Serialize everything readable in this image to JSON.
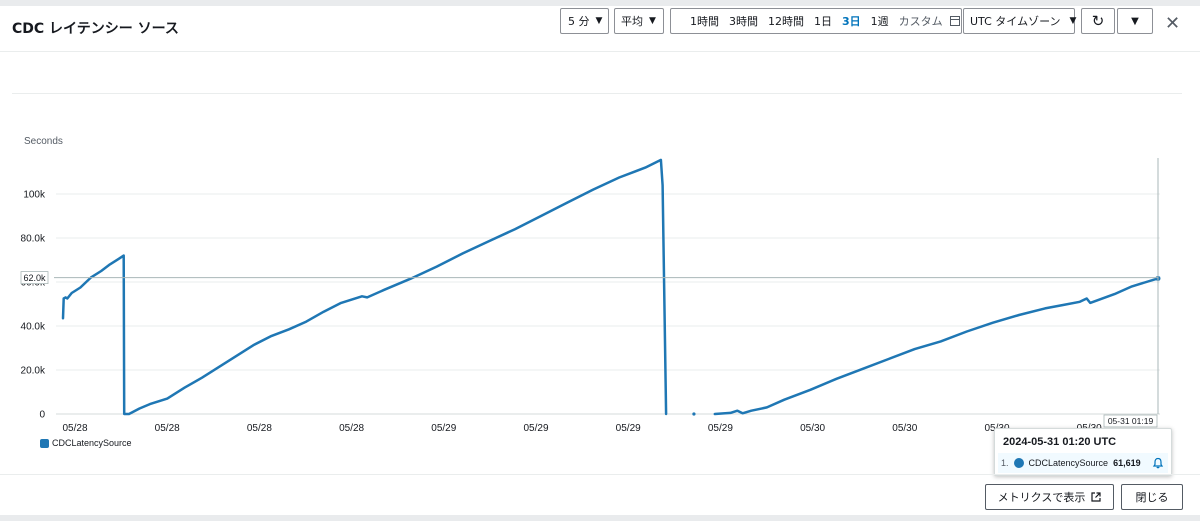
{
  "title": "CDC レイテンシー ソース",
  "controls": {
    "period": "5 分",
    "statistic": "平均",
    "ranges": [
      "1時間",
      "3時間",
      "12時間",
      "1日",
      "3日",
      "1週"
    ],
    "active_range": "3日",
    "custom": "カスタム",
    "timezone": "UTC タイムゾーン"
  },
  "icons": [
    "chevron-down-icon",
    "calendar-icon",
    "refresh-icon",
    "close-icon",
    "bell-icon",
    "external-link-icon"
  ],
  "tooltip": {
    "time": "2024-05-31 01:20 UTC",
    "index": "1.",
    "series": "CDCLatencySource",
    "value": "61,619"
  },
  "cursor_label": "05-31 01:19",
  "buttons": {
    "view_metrics": "メトリクスで表示",
    "close": "閉じる"
  },
  "chart_data": {
    "type": "line",
    "ylabel": "Seconds",
    "ylim": [
      0,
      120000
    ],
    "yticks": [
      {
        "value": 0,
        "label": "0"
      },
      {
        "value": 20000,
        "label": "20.0k"
      },
      {
        "value": 40000,
        "label": "40.0k"
      },
      {
        "value": 60000,
        "label": "60.0k"
      },
      {
        "value": 80000,
        "label": "80.0k"
      },
      {
        "value": 100000,
        "label": "100k"
      }
    ],
    "xticks": [
      "05/28",
      "05/28",
      "05/28",
      "05/28",
      "05/29",
      "05/29",
      "05/29",
      "05/29",
      "05/30",
      "05/30",
      "05/30",
      "05/30"
    ],
    "grid": true,
    "legend": "bottom-left",
    "color": "#1f77b4",
    "crosshair_value": 62000,
    "crosshair_label": "62.0k",
    "series": [
      {
        "name": "CDCLatencySource",
        "segments": [
          [
            [
              0,
              43500
            ],
            [
              0.4,
              52500
            ],
            [
              1.5,
              53000
            ],
            [
              2.5,
              52500
            ],
            [
              5,
              55000
            ],
            [
              10,
              57500
            ],
            [
              16,
              62000
            ],
            [
              22,
              65000
            ],
            [
              27,
              68000
            ],
            [
              32,
              70500
            ],
            [
              34.9,
              72000
            ],
            [
              35.2,
              0
            ],
            [
              38,
              0
            ],
            [
              44,
              2500
            ],
            [
              50,
              4500
            ],
            [
              60,
              7000
            ],
            [
              70,
              12000
            ],
            [
              80,
              16500
            ],
            [
              90,
              21500
            ],
            [
              100,
              26500
            ],
            [
              110,
              31500
            ],
            [
              120,
              35500
            ],
            [
              130,
              38500
            ],
            [
              140,
              42000
            ],
            [
              150,
              46500
            ],
            [
              160,
              50500
            ],
            [
              172,
              53500
            ],
            [
              175,
              53000
            ],
            [
              185,
              56500
            ],
            [
              200,
              61500
            ],
            [
              215,
              67000
            ],
            [
              230,
              73000
            ],
            [
              245,
              78500
            ],
            [
              260,
              84000
            ],
            [
              275,
              90000
            ],
            [
              290,
              96000
            ],
            [
              305,
              102000
            ],
            [
              320,
              107500
            ],
            [
              335,
              112000
            ],
            [
              344,
              115500
            ],
            [
              345,
              104000
            ],
            [
              347,
              0
            ]
          ],
          [
            [
              363,
              0
            ]
          ],
          [
            [
              375,
              0
            ],
            [
              384,
              500
            ],
            [
              388,
              1500
            ],
            [
              391,
              300
            ],
            [
              396,
              1500
            ],
            [
              405,
              3000
            ],
            [
              415,
              6500
            ],
            [
              430,
              11000
            ],
            [
              445,
              16000
            ],
            [
              460,
              20500
            ],
            [
              475,
              25000
            ],
            [
              490,
              29500
            ],
            [
              505,
              33000
            ],
            [
              520,
              37500
            ],
            [
              535,
              41500
            ],
            [
              550,
              45000
            ],
            [
              565,
              48000
            ],
            [
              575,
              49500
            ],
            [
              585,
              51000
            ],
            [
              589,
              52500
            ],
            [
              591,
              50500
            ],
            [
              605,
              54500
            ],
            [
              615,
              58000
            ],
            [
              630,
              61619
            ]
          ]
        ]
      }
    ]
  }
}
